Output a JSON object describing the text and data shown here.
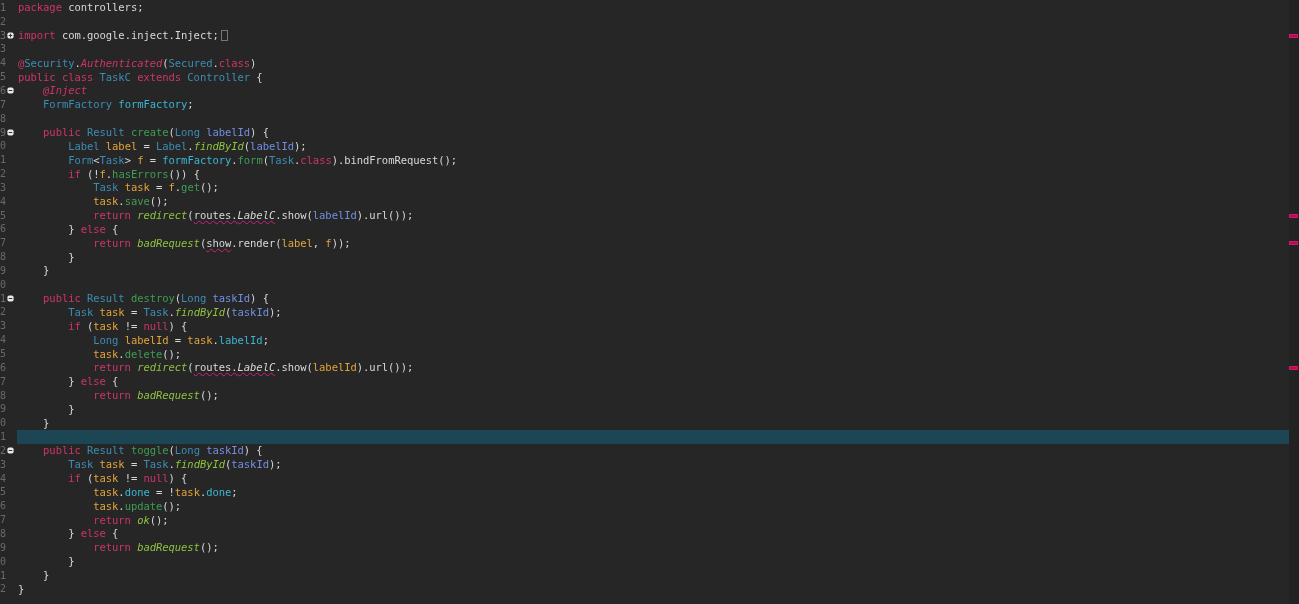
{
  "editor": {
    "lines": [
      {
        "number": "1",
        "current": false,
        "marker": false,
        "tokens": [
          {
            "kind": "keyword",
            "text": "package"
          },
          {
            "kind": "plain",
            "text": " controllers;"
          }
        ]
      },
      {
        "number": "2",
        "current": false,
        "marker": false
      },
      {
        "number": "3",
        "current": false,
        "marker": true,
        "collapsed": true,
        "tokens": [
          {
            "kind": "keyword",
            "text": "import"
          },
          {
            "kind": "plain",
            "text": " com.google.inject.Inject;"
          }
        ]
      },
      {
        "number": "3",
        "current": false,
        "marker": false
      },
      {
        "number": "4",
        "current": false,
        "marker": false,
        "tokens": [
          {
            "kind": "keyword",
            "text": "@"
          },
          {
            "kind": "type",
            "text": "Security"
          },
          {
            "kind": "plain",
            "text": "."
          },
          {
            "kind": "annotation",
            "text": "Authenticated"
          },
          {
            "kind": "plain",
            "text": "("
          },
          {
            "kind": "type",
            "text": "Secured"
          },
          {
            "kind": "plain",
            "text": "."
          },
          {
            "kind": "keyword",
            "text": "class"
          },
          {
            "kind": "plain",
            "text": ")"
          }
        ]
      },
      {
        "number": "5",
        "current": false,
        "marker": false,
        "tokens": [
          {
            "kind": "keyword",
            "text": "public class "
          },
          {
            "kind": "type",
            "text": "TaskC"
          },
          {
            "kind": "keyword",
            "text": " extends "
          },
          {
            "kind": "type",
            "text": "Controller"
          },
          {
            "kind": "plain",
            "text": " {"
          }
        ]
      },
      {
        "number": "6",
        "current": false,
        "marker": false,
        "collapsed": false,
        "tokens": [
          {
            "kind": "annotation",
            "text": "    @Inject"
          }
        ]
      },
      {
        "number": "7",
        "current": false,
        "marker": false,
        "tokens": [
          {
            "kind": "type",
            "text": "    FormFactory "
          },
          {
            "kind": "field",
            "text": "formFactory"
          },
          {
            "kind": "plain",
            "text": ";"
          }
        ]
      },
      {
        "number": "8",
        "current": false,
        "marker": false
      },
      {
        "number": "9",
        "current": false,
        "marker": false,
        "collapsed": false,
        "tokens": [
          {
            "kind": "keyword",
            "text": "    public "
          },
          {
            "kind": "type",
            "text": "Result "
          },
          {
            "kind": "method",
            "text": "create"
          },
          {
            "kind": "plain",
            "text": "("
          },
          {
            "kind": "type",
            "text": "Long "
          },
          {
            "kind": "param",
            "text": "labelId"
          },
          {
            "kind": "plain",
            "text": ") {"
          }
        ]
      },
      {
        "number": "0",
        "current": false,
        "marker": false,
        "tokens": [
          {
            "kind": "type",
            "text": "        Label "
          },
          {
            "kind": "local",
            "text": "label"
          },
          {
            "kind": "plain",
            "text": " = "
          },
          {
            "kind": "type",
            "text": "Label"
          },
          {
            "kind": "plain",
            "text": "."
          },
          {
            "kind": "call",
            "text": "findById"
          },
          {
            "kind": "plain",
            "text": "("
          },
          {
            "kind": "param",
            "text": "labelId"
          },
          {
            "kind": "plain",
            "text": ");"
          }
        ]
      },
      {
        "number": "1",
        "current": false,
        "marker": false,
        "tokens": [
          {
            "kind": "type",
            "text": "        Form"
          },
          {
            "kind": "plain",
            "text": "<"
          },
          {
            "kind": "type",
            "text": "Task"
          },
          {
            "kind": "plain",
            "text": "> "
          },
          {
            "kind": "local",
            "text": "f"
          },
          {
            "kind": "plain",
            "text": " = "
          },
          {
            "kind": "field",
            "text": "formFactory"
          },
          {
            "kind": "plain",
            "text": "."
          },
          {
            "kind": "method",
            "text": "form"
          },
          {
            "kind": "plain",
            "text": "("
          },
          {
            "kind": "type",
            "text": "Task"
          },
          {
            "kind": "plain",
            "text": "."
          },
          {
            "kind": "keyword",
            "text": "class"
          },
          {
            "kind": "plain",
            "text": ").bindFromRequest();"
          }
        ]
      },
      {
        "number": "2",
        "current": false,
        "marker": false,
        "tokens": [
          {
            "kind": "keyword",
            "text": "        if"
          },
          {
            "kind": "plain",
            "text": " (!"
          },
          {
            "kind": "local",
            "text": "f"
          },
          {
            "kind": "plain",
            "text": "."
          },
          {
            "kind": "method",
            "text": "hasErrors"
          },
          {
            "kind": "plain",
            "text": "()) {"
          }
        ]
      },
      {
        "number": "3",
        "current": false,
        "marker": false,
        "tokens": [
          {
            "kind": "type",
            "text": "            Task "
          },
          {
            "kind": "local",
            "text": "task"
          },
          {
            "kind": "plain",
            "text": " = "
          },
          {
            "kind": "local",
            "text": "f"
          },
          {
            "kind": "plain",
            "text": "."
          },
          {
            "kind": "method",
            "text": "get"
          },
          {
            "kind": "plain",
            "text": "();"
          }
        ]
      },
      {
        "number": "4",
        "current": false,
        "marker": false,
        "tokens": [
          {
            "kind": "local",
            "text": "            task"
          },
          {
            "kind": "plain",
            "text": "."
          },
          {
            "kind": "method",
            "text": "save"
          },
          {
            "kind": "plain",
            "text": "();"
          }
        ]
      },
      {
        "number": "5",
        "current": false,
        "marker": true,
        "tokens": [
          {
            "kind": "keyword",
            "text": "            return "
          },
          {
            "kind": "call",
            "text": "redirect"
          },
          {
            "kind": "plain",
            "text": "("
          },
          {
            "kind": "plain",
            "text": "routes.",
            "error": true
          },
          {
            "kind": "italic",
            "text": "LabelC",
            "error": true
          },
          {
            "kind": "plain",
            "text": ".show("
          },
          {
            "kind": "param",
            "text": "labelId"
          },
          {
            "kind": "plain",
            "text": ").url());"
          }
        ]
      },
      {
        "number": "6",
        "current": false,
        "marker": false,
        "tokens": [
          {
            "kind": "plain",
            "text": "        } "
          },
          {
            "kind": "keyword",
            "text": "else"
          },
          {
            "kind": "plain",
            "text": " {"
          }
        ]
      },
      {
        "number": "7",
        "current": false,
        "marker": true,
        "tokens": [
          {
            "kind": "keyword",
            "text": "            return "
          },
          {
            "kind": "call",
            "text": "badRequest"
          },
          {
            "kind": "plain",
            "text": "("
          },
          {
            "kind": "plain",
            "text": "show",
            "error": true
          },
          {
            "kind": "plain",
            "text": ".render("
          },
          {
            "kind": "local",
            "text": "label"
          },
          {
            "kind": "plain",
            "text": ", "
          },
          {
            "kind": "local",
            "text": "f"
          },
          {
            "kind": "plain",
            "text": "));"
          }
        ]
      },
      {
        "number": "8",
        "current": false,
        "marker": false,
        "tokens": [
          {
            "kind": "plain",
            "text": "        }"
          }
        ]
      },
      {
        "number": "9",
        "current": false,
        "marker": false,
        "tokens": [
          {
            "kind": "plain",
            "text": "    }"
          }
        ]
      },
      {
        "number": "0",
        "current": false,
        "marker": false
      },
      {
        "number": "1",
        "current": false,
        "marker": false,
        "collapsed": false,
        "tokens": [
          {
            "kind": "keyword",
            "text": "    public "
          },
          {
            "kind": "type",
            "text": "Result "
          },
          {
            "kind": "method",
            "text": "destroy"
          },
          {
            "kind": "plain",
            "text": "("
          },
          {
            "kind": "type",
            "text": "Long "
          },
          {
            "kind": "param",
            "text": "taskId"
          },
          {
            "kind": "plain",
            "text": ") {"
          }
        ]
      },
      {
        "number": "2",
        "current": false,
        "marker": false,
        "tokens": [
          {
            "kind": "type",
            "text": "        Task "
          },
          {
            "kind": "local",
            "text": "task"
          },
          {
            "kind": "plain",
            "text": " = "
          },
          {
            "kind": "type",
            "text": "Task"
          },
          {
            "kind": "plain",
            "text": "."
          },
          {
            "kind": "call",
            "text": "findById"
          },
          {
            "kind": "plain",
            "text": "("
          },
          {
            "kind": "param",
            "text": "taskId"
          },
          {
            "kind": "plain",
            "text": ");"
          }
        ]
      },
      {
        "number": "3",
        "current": false,
        "marker": false,
        "tokens": [
          {
            "kind": "keyword",
            "text": "        if"
          },
          {
            "kind": "plain",
            "text": " ("
          },
          {
            "kind": "local",
            "text": "task"
          },
          {
            "kind": "plain",
            "text": " != "
          },
          {
            "kind": "keyword",
            "text": "null"
          },
          {
            "kind": "plain",
            "text": ") {"
          }
        ]
      },
      {
        "number": "4",
        "current": false,
        "marker": false,
        "tokens": [
          {
            "kind": "type",
            "text": "            Long "
          },
          {
            "kind": "local",
            "text": "labelId"
          },
          {
            "kind": "plain",
            "text": " = "
          },
          {
            "kind": "local",
            "text": "task"
          },
          {
            "kind": "plain",
            "text": "."
          },
          {
            "kind": "field",
            "text": "labelId"
          },
          {
            "kind": "plain",
            "text": ";"
          }
        ]
      },
      {
        "number": "5",
        "current": false,
        "marker": false,
        "tokens": [
          {
            "kind": "local",
            "text": "            task"
          },
          {
            "kind": "plain",
            "text": "."
          },
          {
            "kind": "method",
            "text": "delete"
          },
          {
            "kind": "plain",
            "text": "();"
          }
        ]
      },
      {
        "number": "6",
        "current": false,
        "marker": true,
        "tokens": [
          {
            "kind": "keyword",
            "text": "            return "
          },
          {
            "kind": "call",
            "text": "redirect"
          },
          {
            "kind": "plain",
            "text": "("
          },
          {
            "kind": "plain",
            "text": "routes.",
            "error": true
          },
          {
            "kind": "italic",
            "text": "LabelC",
            "error": true
          },
          {
            "kind": "plain",
            "text": ".show("
          },
          {
            "kind": "local",
            "text": "labelId"
          },
          {
            "kind": "plain",
            "text": ").url());"
          }
        ]
      },
      {
        "number": "7",
        "current": false,
        "marker": false,
        "tokens": [
          {
            "kind": "plain",
            "text": "        } "
          },
          {
            "kind": "keyword",
            "text": "else"
          },
          {
            "kind": "plain",
            "text": " {"
          }
        ]
      },
      {
        "number": "8",
        "current": false,
        "marker": false,
        "tokens": [
          {
            "kind": "keyword",
            "text": "            return "
          },
          {
            "kind": "call",
            "text": "badRequest"
          },
          {
            "kind": "plain",
            "text": "();"
          }
        ]
      },
      {
        "number": "9",
        "current": false,
        "marker": false,
        "tokens": [
          {
            "kind": "plain",
            "text": "        }"
          }
        ]
      },
      {
        "number": "0",
        "current": false,
        "marker": false,
        "tokens": [
          {
            "kind": "plain",
            "text": "    }"
          }
        ]
      },
      {
        "number": "1",
        "current": true,
        "marker": false
      },
      {
        "number": "2",
        "current": false,
        "marker": false,
        "collapsed": false,
        "tokens": [
          {
            "kind": "keyword",
            "text": "    public "
          },
          {
            "kind": "type",
            "text": "Result "
          },
          {
            "kind": "method",
            "text": "toggle"
          },
          {
            "kind": "plain",
            "text": "("
          },
          {
            "kind": "type",
            "text": "Long "
          },
          {
            "kind": "param",
            "text": "taskId"
          },
          {
            "kind": "plain",
            "text": ") {"
          }
        ]
      },
      {
        "number": "3",
        "current": false,
        "marker": false,
        "tokens": [
          {
            "kind": "type",
            "text": "        Task "
          },
          {
            "kind": "local",
            "text": "task"
          },
          {
            "kind": "plain",
            "text": " = "
          },
          {
            "kind": "type",
            "text": "Task"
          },
          {
            "kind": "plain",
            "text": "."
          },
          {
            "kind": "call",
            "text": "findById"
          },
          {
            "kind": "plain",
            "text": "("
          },
          {
            "kind": "param",
            "text": "taskId"
          },
          {
            "kind": "plain",
            "text": ");"
          }
        ]
      },
      {
        "number": "4",
        "current": false,
        "marker": false,
        "tokens": [
          {
            "kind": "keyword",
            "text": "        if"
          },
          {
            "kind": "plain",
            "text": " ("
          },
          {
            "kind": "local",
            "text": "task"
          },
          {
            "kind": "plain",
            "text": " != "
          },
          {
            "kind": "keyword",
            "text": "null"
          },
          {
            "kind": "plain",
            "text": ") {"
          }
        ]
      },
      {
        "number": "5",
        "current": false,
        "marker": false,
        "tokens": [
          {
            "kind": "local",
            "text": "            task"
          },
          {
            "kind": "plain",
            "text": "."
          },
          {
            "kind": "field",
            "text": "done"
          },
          {
            "kind": "plain",
            "text": " = !"
          },
          {
            "kind": "local",
            "text": "task"
          },
          {
            "kind": "plain",
            "text": "."
          },
          {
            "kind": "field",
            "text": "done"
          },
          {
            "kind": "plain",
            "text": ";"
          }
        ]
      },
      {
        "number": "6",
        "current": false,
        "marker": false,
        "tokens": [
          {
            "kind": "local",
            "text": "            task"
          },
          {
            "kind": "plain",
            "text": "."
          },
          {
            "kind": "method",
            "text": "update"
          },
          {
            "kind": "plain",
            "text": "();"
          }
        ]
      },
      {
        "number": "7",
        "current": false,
        "marker": false,
        "tokens": [
          {
            "kind": "keyword",
            "text": "            return "
          },
          {
            "kind": "call",
            "text": "ok"
          },
          {
            "kind": "plain",
            "text": "();"
          }
        ]
      },
      {
        "number": "8",
        "current": false,
        "marker": false,
        "tokens": [
          {
            "kind": "plain",
            "text": "        } "
          },
          {
            "kind": "keyword",
            "text": "else"
          },
          {
            "kind": "plain",
            "text": " {"
          }
        ]
      },
      {
        "number": "9",
        "current": false,
        "marker": false,
        "tokens": [
          {
            "kind": "keyword",
            "text": "            return "
          },
          {
            "kind": "call",
            "text": "badRequest"
          },
          {
            "kind": "plain",
            "text": "();"
          }
        ]
      },
      {
        "number": "0",
        "current": false,
        "marker": false,
        "tokens": [
          {
            "kind": "plain",
            "text": "        }"
          }
        ]
      },
      {
        "number": "1",
        "current": false,
        "marker": false,
        "tokens": [
          {
            "kind": "plain",
            "text": "    }"
          }
        ]
      },
      {
        "number": "2",
        "current": false,
        "marker": false,
        "tokens": [
          {
            "kind": "plain",
            "text": "}"
          }
        ]
      }
    ]
  }
}
